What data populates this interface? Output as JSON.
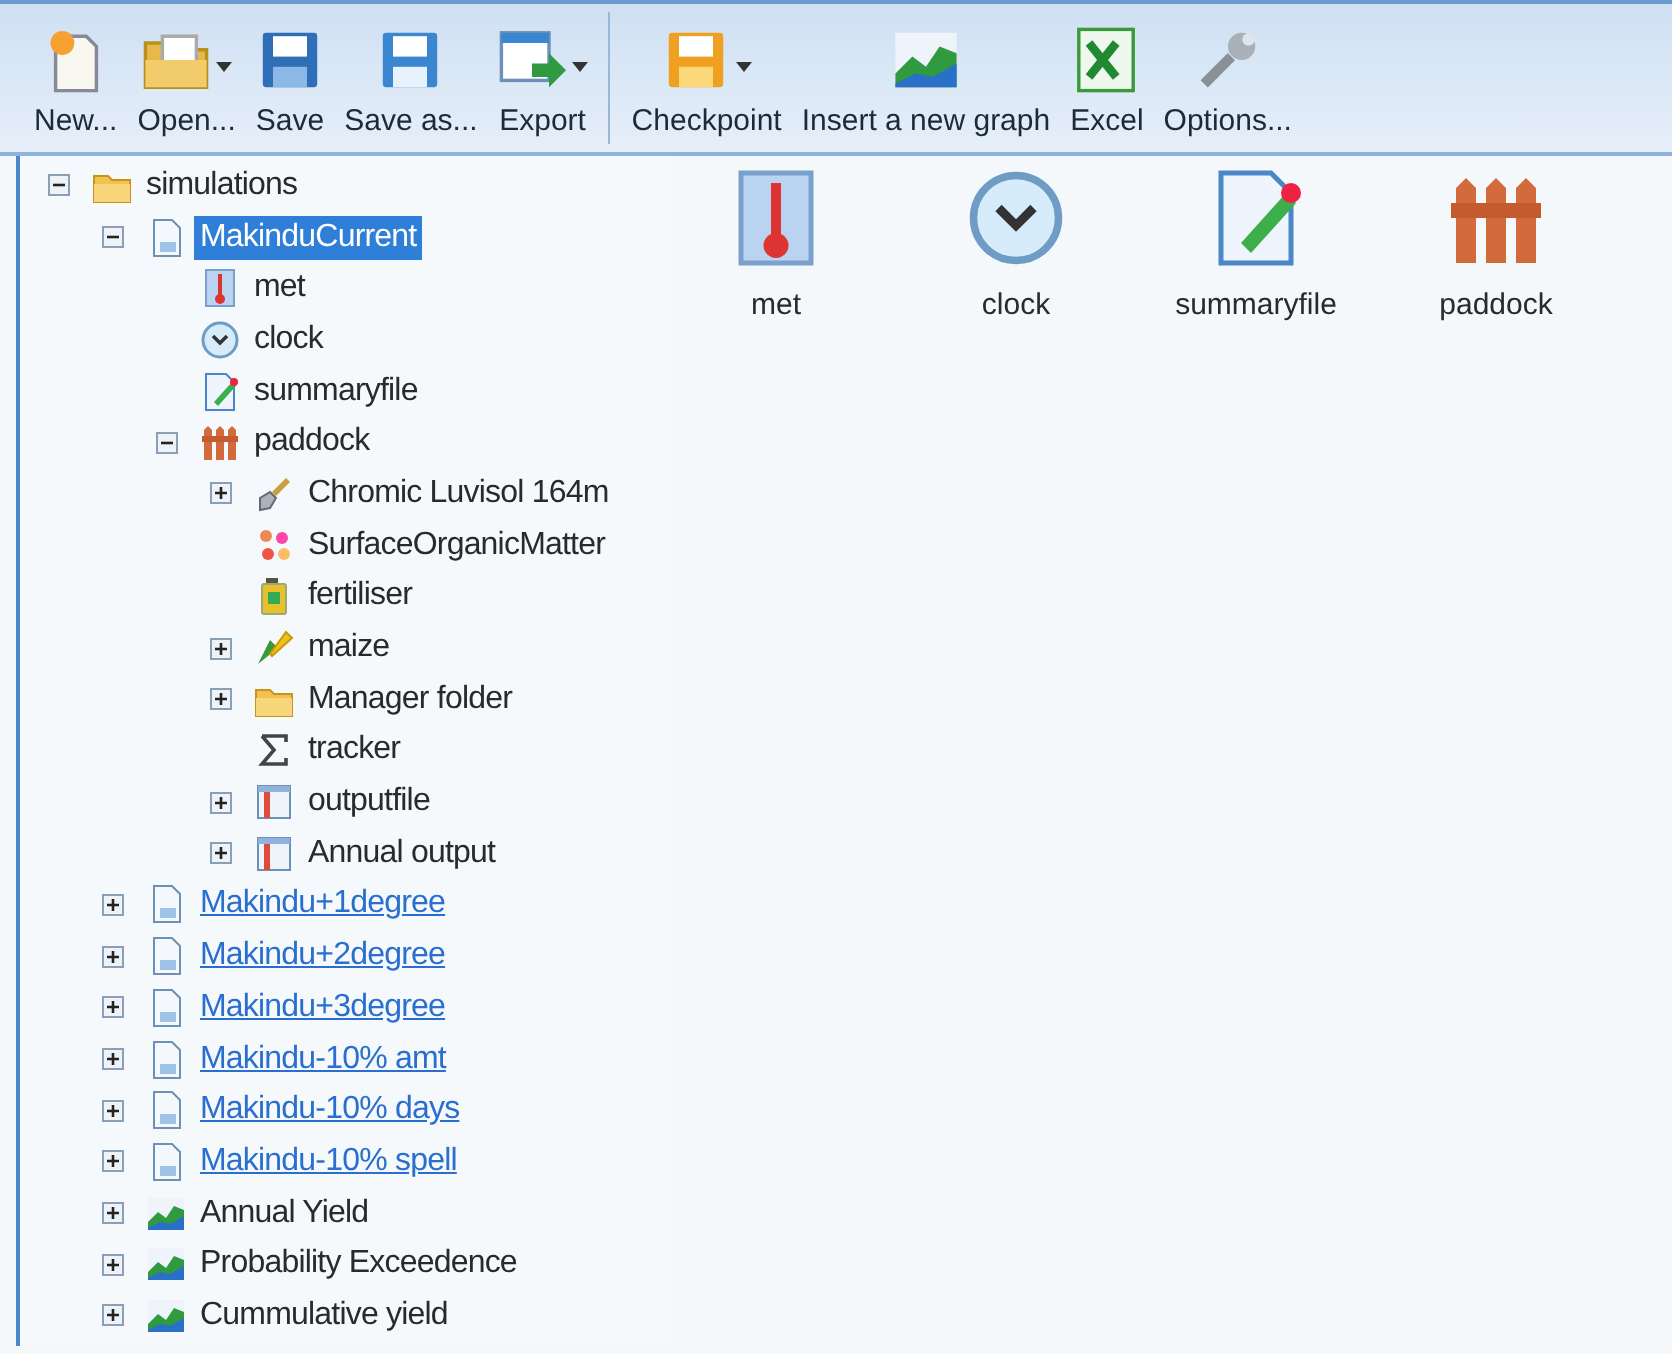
{
  "toolbar": [
    {
      "label": "New...",
      "kind": "new",
      "dropdown": false
    },
    {
      "label": "Open...",
      "kind": "open",
      "dropdown": true
    },
    {
      "label": "Save",
      "kind": "save",
      "dropdown": false
    },
    {
      "label": "Save as...",
      "kind": "saveas",
      "dropdown": false
    },
    {
      "label": "Export",
      "kind": "export",
      "dropdown": true,
      "separator_after": true
    },
    {
      "label": "Checkpoint",
      "kind": "checkpoint",
      "dropdown": true
    },
    {
      "label": "Insert a new graph",
      "kind": "graph",
      "dropdown": false
    },
    {
      "label": "Excel",
      "kind": "excel",
      "dropdown": false
    },
    {
      "label": "Options...",
      "kind": "options",
      "dropdown": false
    }
  ],
  "tree": [
    {
      "label": "simulations",
      "kind": "folder",
      "expanded": true,
      "selected": false,
      "children": [
        {
          "label": "MakinduCurrent",
          "kind": "sim",
          "expanded": true,
          "selected": true,
          "children": [
            {
              "label": "met",
              "kind": "met",
              "selected": false
            },
            {
              "label": "clock",
              "kind": "clock",
              "selected": false
            },
            {
              "label": "summaryfile",
              "kind": "summary",
              "selected": false
            },
            {
              "label": "paddock",
              "kind": "paddock",
              "expanded": true,
              "selected": false,
              "children": [
                {
                  "label": "Chromic Luvisol 164m",
                  "kind": "soil",
                  "expanded": false,
                  "selected": false
                },
                {
                  "label": "SurfaceOrganicMatter",
                  "kind": "som",
                  "selected": false
                },
                {
                  "label": "fertiliser",
                  "kind": "fertiliser",
                  "selected": false
                },
                {
                  "label": "maize",
                  "kind": "maize",
                  "expanded": false,
                  "selected": false
                },
                {
                  "label": "Manager folder",
                  "kind": "folder",
                  "expanded": false,
                  "selected": false
                },
                {
                  "label": "tracker",
                  "kind": "tracker",
                  "selected": false
                },
                {
                  "label": "outputfile",
                  "kind": "output",
                  "expanded": false,
                  "selected": false
                },
                {
                  "label": "Annual output",
                  "kind": "output",
                  "expanded": false,
                  "selected": false
                }
              ]
            }
          ]
        },
        {
          "label": "Makindu+1degree",
          "kind": "sim",
          "expanded": false,
          "selected": false,
          "linked": true
        },
        {
          "label": "Makindu+2degree",
          "kind": "sim",
          "expanded": false,
          "selected": false,
          "linked": true
        },
        {
          "label": "Makindu+3degree",
          "kind": "sim",
          "expanded": false,
          "selected": false,
          "linked": true
        },
        {
          "label": "Makindu-10% amt",
          "kind": "sim",
          "expanded": false,
          "selected": false,
          "linked": true
        },
        {
          "label": "Makindu-10% days",
          "kind": "sim",
          "expanded": false,
          "selected": false,
          "linked": true
        },
        {
          "label": "Makindu-10% spell",
          "kind": "sim",
          "expanded": false,
          "selected": false,
          "linked": true
        },
        {
          "label": "Annual Yield",
          "kind": "graph",
          "expanded": false,
          "selected": false
        },
        {
          "label": "Probability Exceedence",
          "kind": "graph",
          "expanded": false,
          "selected": false
        },
        {
          "label": "Cummulative yield",
          "kind": "graph",
          "expanded": false,
          "selected": false
        }
      ]
    }
  ],
  "panel_items": [
    {
      "label": "met",
      "kind": "met"
    },
    {
      "label": "clock",
      "kind": "clock"
    },
    {
      "label": "summaryfile",
      "kind": "summary"
    },
    {
      "label": "paddock",
      "kind": "paddock"
    }
  ]
}
